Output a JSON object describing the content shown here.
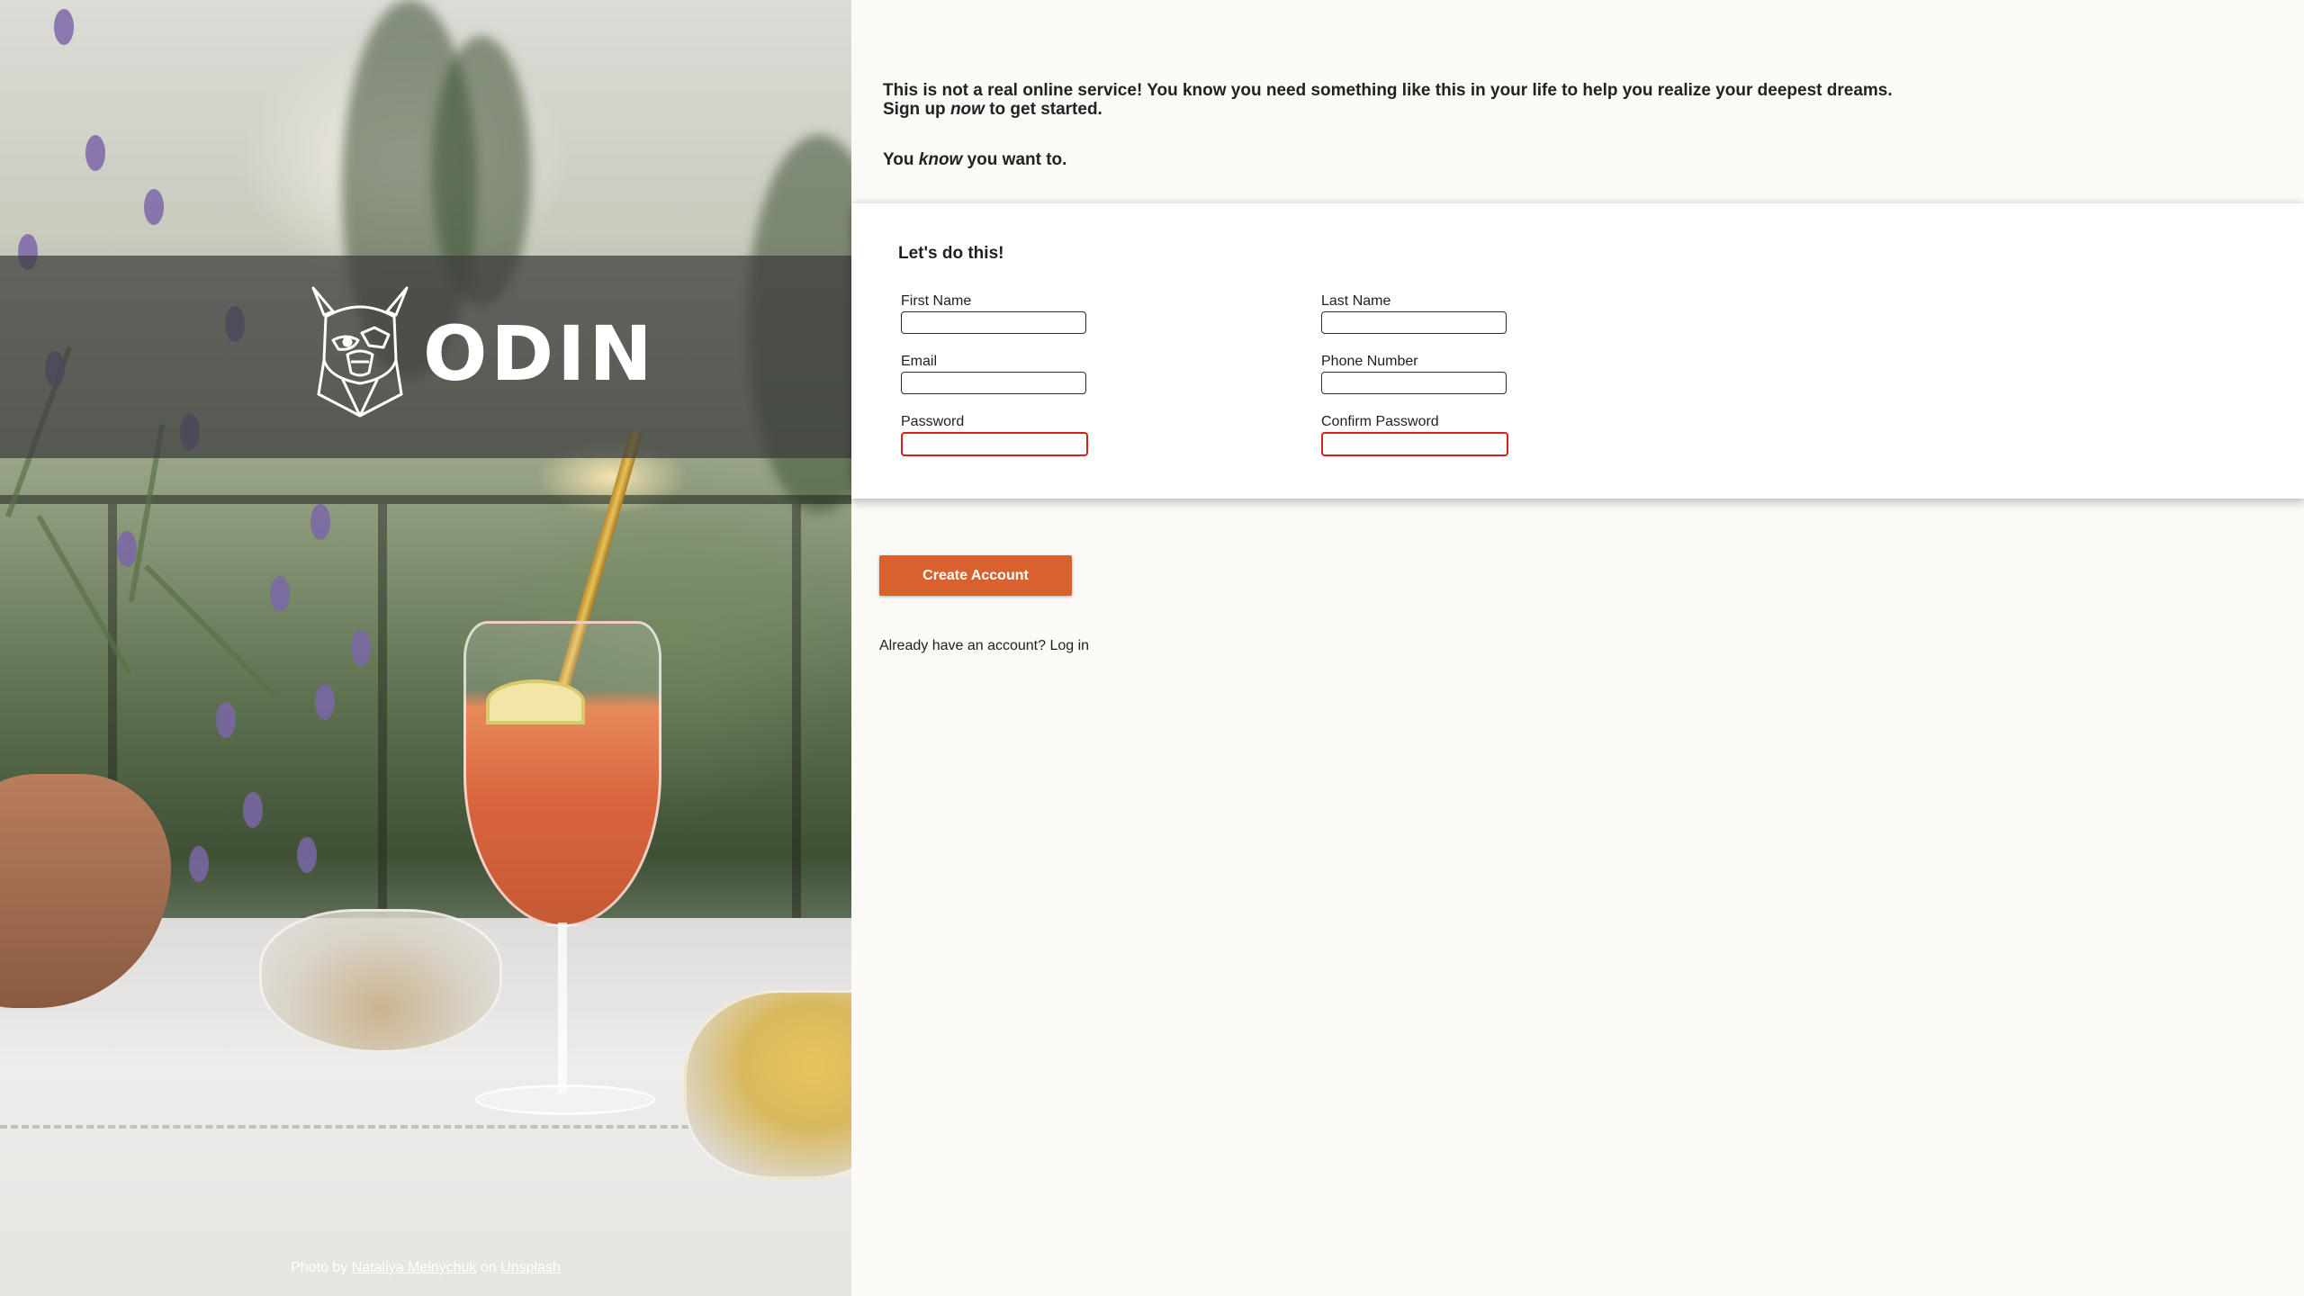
{
  "hero": {
    "logo_text": "ODIN",
    "photo_credit": {
      "prefix": "Photo by",
      "author": "Nataliya Melnychuk",
      "middle": "on",
      "site": "Unsplash"
    }
  },
  "intro": {
    "line1": "This is not a real online service! You know you need something like this in your life to help you realize your deepest dreams.",
    "line2_before": "Sign up ",
    "line2_em": "now",
    "line2_after": " to get started.",
    "line3_before": "You ",
    "line3_em": "know",
    "line3_after": " you want to."
  },
  "form": {
    "title": "Let's do this!",
    "fields": {
      "first_name": {
        "label": "First Name",
        "value": ""
      },
      "last_name": {
        "label": "Last Name",
        "value": ""
      },
      "email": {
        "label": "Email",
        "value": ""
      },
      "phone": {
        "label": "Phone Number",
        "value": ""
      },
      "password": {
        "label": "Password",
        "value": ""
      },
      "confirm_password": {
        "label": "Confirm Password",
        "value": ""
      }
    }
  },
  "actions": {
    "create_account_label": "Create Account",
    "login_prompt": "Already have an account?",
    "login_link": "Log in"
  },
  "colors": {
    "accent": "#d9612e",
    "invalid_border": "#d4221a",
    "page_background": "#fcfaf6"
  },
  "icons": {
    "logo": "viking-helmet-icon"
  }
}
